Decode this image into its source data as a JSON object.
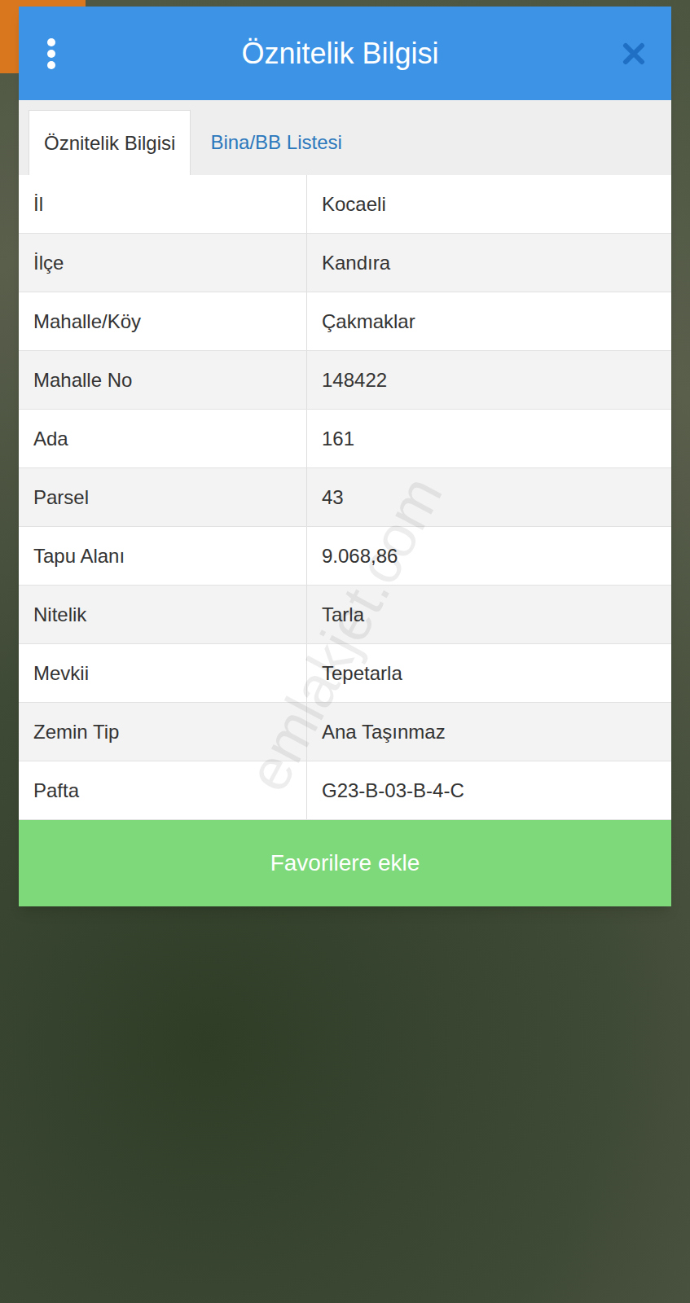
{
  "dialog": {
    "title": "Öznitelik Bilgisi",
    "tabs": [
      {
        "label": "Öznitelik Bilgisi",
        "selected": true
      },
      {
        "label": "Bina/BB Listesi",
        "selected": false
      }
    ],
    "rows": [
      {
        "label": "İl",
        "value": "Kocaeli"
      },
      {
        "label": "İlçe",
        "value": "Kandıra"
      },
      {
        "label": "Mahalle/Köy",
        "value": "Çakmaklar"
      },
      {
        "label": "Mahalle No",
        "value": "148422"
      },
      {
        "label": "Ada",
        "value": "161"
      },
      {
        "label": "Parsel",
        "value": "43"
      },
      {
        "label": "Tapu Alanı",
        "value": "9.068,86"
      },
      {
        "label": "Nitelik",
        "value": "Tarla"
      },
      {
        "label": "Mevkii",
        "value": "Tepetarla"
      },
      {
        "label": "Zemin Tip",
        "value": "Ana Taşınmaz"
      },
      {
        "label": "Pafta",
        "value": "G23-B-03-B-4-C"
      }
    ],
    "button": "Favorilere ekle"
  },
  "watermark": "emlakjet.com"
}
